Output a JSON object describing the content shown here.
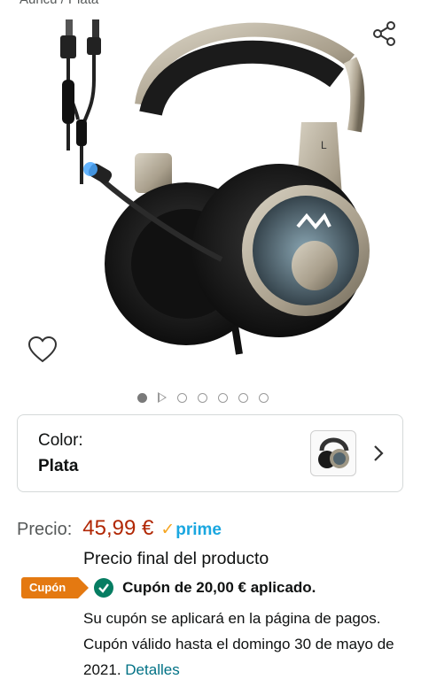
{
  "header": {
    "cut_text": "Auricu / Plata",
    "share_icon": "share-icon"
  },
  "gallery": {
    "image_alt": "headset-image",
    "wishlist_icon": "heart-icon",
    "dots": [
      "active",
      "video",
      "dot",
      "dot",
      "dot",
      "dot",
      "dot"
    ]
  },
  "color_selector": {
    "label": "Color:",
    "value": "Plata",
    "chevron_icon": "chevron-right-icon"
  },
  "price": {
    "label": "Precio:",
    "value": "45,99 €",
    "prime_check": "✓",
    "prime_text": "prime",
    "final_note": "Precio final del producto"
  },
  "coupon": {
    "badge": "Cupón",
    "applied_text": "Cupón de 20,00 € aplicado.",
    "info": "Su cupón se aplicará en la página de pagos. Cupón válido hasta el domingo 30 de mayo de 2021.",
    "details_link": "Detalles"
  },
  "colors": {
    "price": "#b12704",
    "prime_blue": "#1aa7e0",
    "coupon_orange": "#e47911",
    "check_green": "#067d62",
    "link": "#007185"
  }
}
